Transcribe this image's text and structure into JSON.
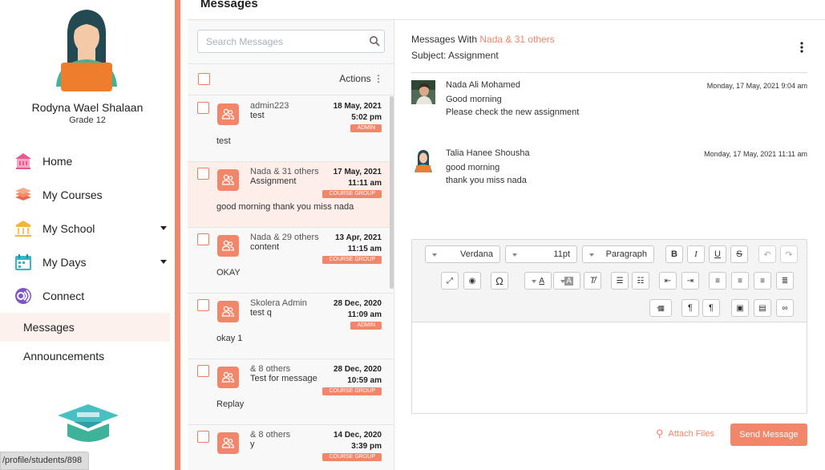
{
  "user": {
    "name": "Rodyna Wael Shalaan",
    "grade": "Grade 12"
  },
  "nav": {
    "home": "Home",
    "courses": "My Courses",
    "school": "My School",
    "days": "My Days",
    "connect": "Connect",
    "messages": "Messages",
    "announcements": "Announcements"
  },
  "status_url": "/profile/students/898",
  "page_title": "Messages",
  "search": {
    "placeholder": "Search Messages"
  },
  "actions_label": "Actions",
  "messages": [
    {
      "from": "admin223",
      "subject": "test",
      "date": "18 May, 2021",
      "time": "5:02 pm",
      "badge": "ADMIN",
      "preview": "test"
    },
    {
      "from": "Nada & 31 others",
      "subject": "Assignment",
      "date": "17 May, 2021",
      "time": "11:11 am",
      "badge": "COURSE GROUP",
      "preview": "good morning thank you miss nada"
    },
    {
      "from": "Nada & 29 others",
      "subject": "content",
      "date": "13 Apr, 2021",
      "time": "11:15 am",
      "badge": "COURSE GROUP",
      "preview": "OKAY"
    },
    {
      "from": "Skolera Admin",
      "subject": "test q",
      "date": "28 Dec, 2020",
      "time": "11:09 am",
      "badge": "ADMIN",
      "preview": "okay 1"
    },
    {
      "from": "& 8 others",
      "subject": "Test for message",
      "date": "28 Dec, 2020",
      "time": "10:59 am",
      "badge": "COURSE GROUP",
      "preview": "Replay"
    },
    {
      "from": "& 8 others",
      "subject": "y",
      "date": "14 Dec, 2020",
      "time": "3:39 pm",
      "badge": "COURSE GROUP",
      "preview": ""
    }
  ],
  "thread": {
    "with_label": "Messages With",
    "participants": "Nada & 31 others",
    "subject_line": "Subject: Assignment",
    "posts": [
      {
        "author": "Nada Ali Mohamed",
        "date": "Monday, 17 May, 2021 9:04 am",
        "line1": "Good morning",
        "line2": "Please check the new assignment"
      },
      {
        "author": "Talia Hanee Shousha",
        "date": "Monday, 17 May, 2021 11:11 am",
        "line1": "good morning",
        "line2": "thank you miss nada"
      }
    ]
  },
  "editor": {
    "font": "Verdana",
    "size": "11pt",
    "block": "Paragraph"
  },
  "attach_label": "Attach Files",
  "send_label": "Send Message",
  "colors": {
    "accent": "#f2866b",
    "selected_row": "#fdeeea",
    "panel": "#f8f8f9"
  }
}
